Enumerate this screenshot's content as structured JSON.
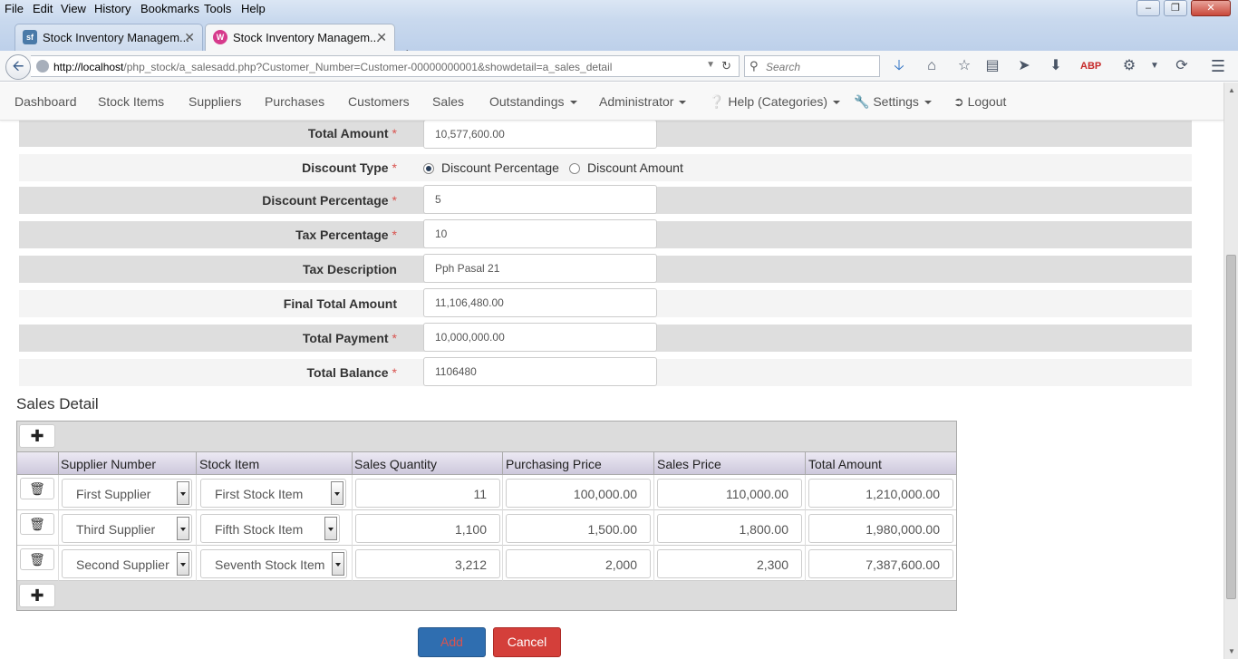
{
  "browser": {
    "menu": [
      "File",
      "Edit",
      "View",
      "History",
      "Bookmarks",
      "Tools",
      "Help"
    ],
    "tabs": [
      {
        "title": "Stock Inventory Managem...",
        "favicon": "sf"
      },
      {
        "title": "Stock Inventory Managem...",
        "favicon": "W"
      }
    ],
    "url_host": "http://localhost",
    "url_path": "/php_stock/a_salesadd.php?Customer_Number=Customer-00000000001&showdetail=a_sales_detail",
    "search_placeholder": "Search"
  },
  "nav": {
    "items": [
      {
        "label": "Dashboard",
        "dropdown": false
      },
      {
        "label": "Stock Items",
        "dropdown": false
      },
      {
        "label": "Suppliers",
        "dropdown": false
      },
      {
        "label": "Purchases",
        "dropdown": false
      },
      {
        "label": "Customers",
        "dropdown": false
      },
      {
        "label": "Sales",
        "dropdown": false
      },
      {
        "label": "Outstandings",
        "dropdown": true
      },
      {
        "label": "Administrator",
        "dropdown": true
      },
      {
        "label": "Help (Categories)",
        "dropdown": true,
        "icon": "question-circle-icon"
      },
      {
        "label": "Settings",
        "dropdown": true,
        "icon": "wrench-icon"
      },
      {
        "label": "Logout",
        "dropdown": false,
        "icon": "logout-icon"
      }
    ]
  },
  "form": {
    "total_amount": {
      "label": "Total Amount",
      "value": "10,577,600.00",
      "required": true
    },
    "discount_type": {
      "label": "Discount Type",
      "required": true,
      "options": [
        "Discount Percentage",
        "Discount Amount"
      ],
      "selected": "Discount Percentage"
    },
    "discount_percentage": {
      "label": "Discount Percentage",
      "value": "5",
      "required": true
    },
    "tax_percentage": {
      "label": "Tax Percentage",
      "value": "10",
      "required": true
    },
    "tax_description": {
      "label": "Tax Description",
      "value": "Pph Pasal 21",
      "required": false
    },
    "final_total_amount": {
      "label": "Final Total Amount",
      "value": "11,106,480.00",
      "required": false
    },
    "total_payment": {
      "label": "Total Payment",
      "value": "10,000,000.00",
      "required": true
    },
    "total_balance": {
      "label": "Total Balance",
      "value": "1106480",
      "required": true
    }
  },
  "sales_detail": {
    "title": "Sales Detail",
    "columns": [
      "Supplier Number",
      "Stock Item",
      "Sales Quantity",
      "Purchasing Price",
      "Sales Price",
      "Total Amount"
    ],
    "rows": [
      {
        "supplier": "First Supplier",
        "stock_item": "First Stock Item",
        "quantity": "11",
        "purchasing_price": "100,000.00",
        "sales_price": "110,000.00",
        "total": "1,210,000.00"
      },
      {
        "supplier": "Third Supplier",
        "stock_item": "Fifth Stock Item",
        "quantity": "1,100",
        "purchasing_price": "1,500.00",
        "sales_price": "1,800.00",
        "total": "1,980,000.00"
      },
      {
        "supplier": "Second Supplier",
        "stock_item": "Seventh Stock Item",
        "quantity": "3,212",
        "purchasing_price": "2,000",
        "sales_price": "2,300",
        "total": "7,387,600.00"
      }
    ]
  },
  "buttons": {
    "add": "Add",
    "cancel": "Cancel"
  }
}
